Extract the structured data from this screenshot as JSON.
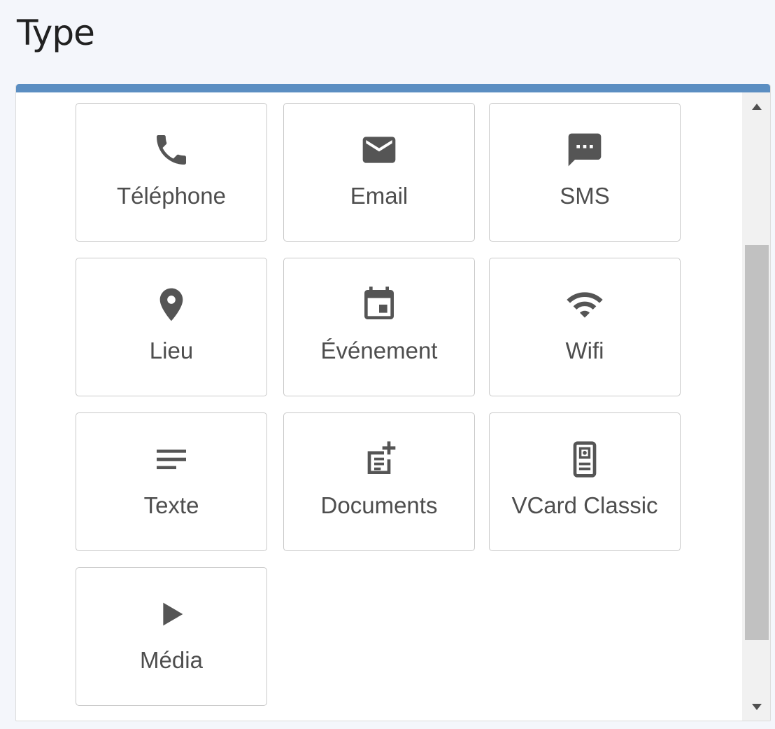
{
  "header": {
    "title": "Type"
  },
  "types": [
    {
      "label": "Téléphone",
      "icon": "phone-icon"
    },
    {
      "label": "Email",
      "icon": "email-icon"
    },
    {
      "label": "SMS",
      "icon": "sms-icon"
    },
    {
      "label": "Lieu",
      "icon": "location-pin-icon"
    },
    {
      "label": "Événement",
      "icon": "calendar-event-icon"
    },
    {
      "label": "Wifi",
      "icon": "wifi-icon"
    },
    {
      "label": "Texte",
      "icon": "text-lines-icon"
    },
    {
      "label": "Documents",
      "icon": "document-add-icon"
    },
    {
      "label": "VCard Classic",
      "icon": "contact-card-icon"
    },
    {
      "label": "Média",
      "icon": "play-icon"
    }
  ],
  "colors": {
    "accent": "#5b8ec2",
    "icon": "#555555",
    "label": "#4e4e4e",
    "tile_border": "#c9c9c9",
    "background": "#f4f6fb"
  }
}
